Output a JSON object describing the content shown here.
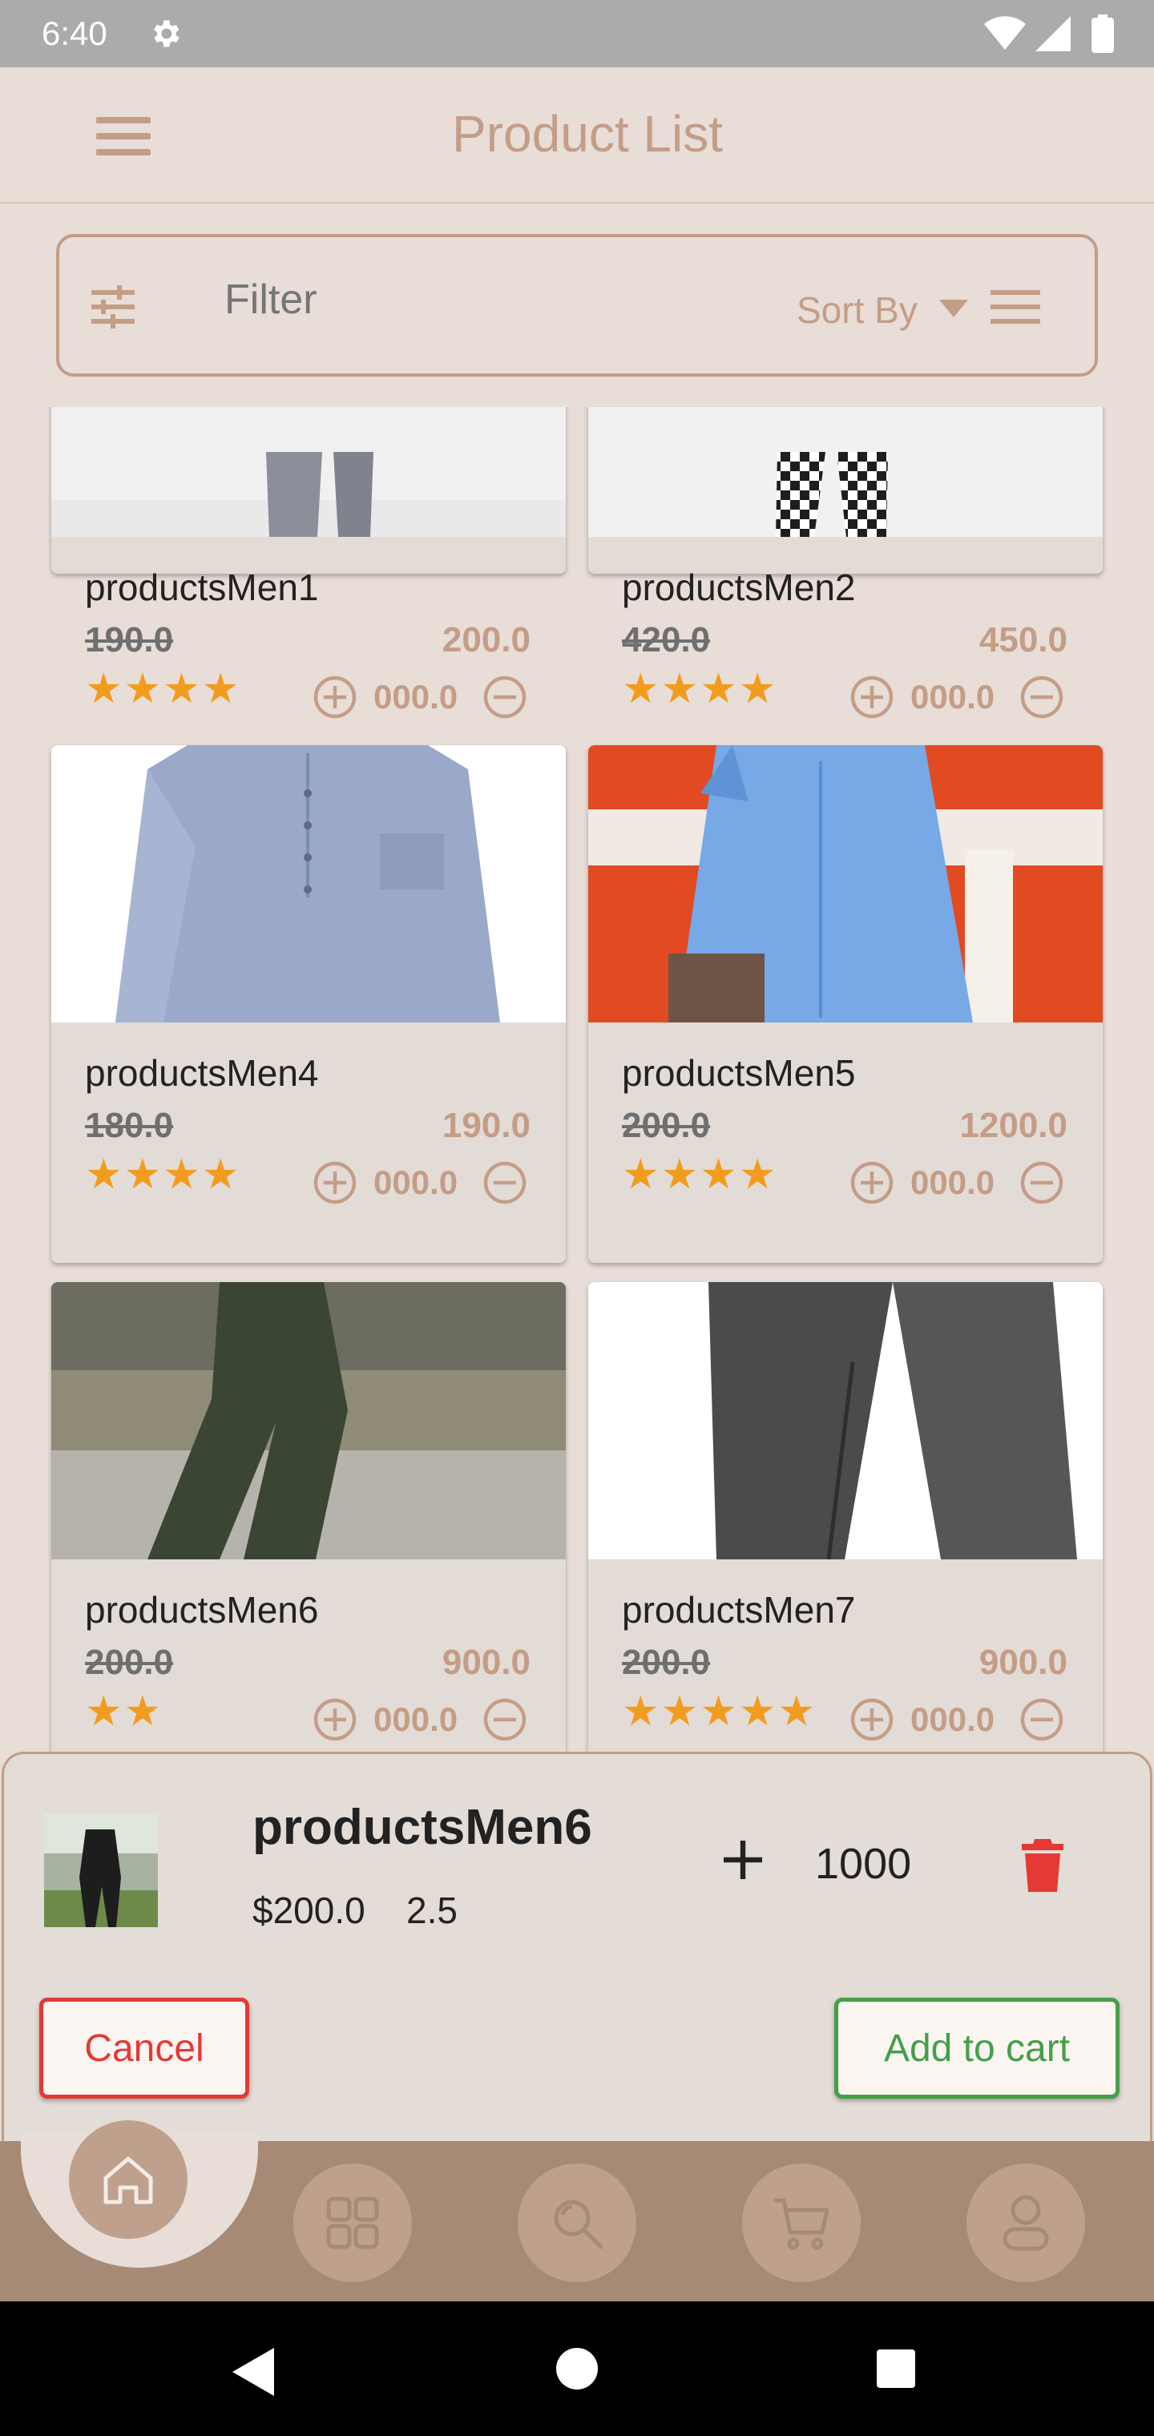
{
  "status_bar": {
    "time": "6:40",
    "icons": [
      "settings-icon",
      "wifi-icon",
      "signal-icon",
      "battery-icon"
    ]
  },
  "app_bar": {
    "title": "Product List",
    "menu_icon": "hamburger-menu-icon"
  },
  "filter_bar": {
    "placeholder": "Filter",
    "sort_label": "Sort By",
    "icons": [
      "sliders-icon",
      "caret-down-icon",
      "list-view-icon"
    ]
  },
  "products": [
    {
      "name": "productsMen1",
      "old_price": "190.0",
      "price": "200.0",
      "stars": "★★★★",
      "qty": "000.0"
    },
    {
      "name": "productsMen2",
      "old_price": "420.0",
      "price": "450.0",
      "stars": "★★★★",
      "qty": "000.0"
    },
    {
      "name": "productsMen4",
      "old_price": "180.0",
      "price": "190.0",
      "stars": "★★★★",
      "qty": "000.0"
    },
    {
      "name": "productsMen5",
      "old_price": "200.0",
      "price": "1200.0",
      "stars": "★★★★",
      "qty": "000.0"
    },
    {
      "name": "productsMen6",
      "old_price": "200.0",
      "price": "900.0",
      "stars": "★★",
      "qty": "000.0"
    },
    {
      "name": "productsMen7",
      "old_price": "200.0",
      "price": "900.0",
      "stars": "★★★★★",
      "qty": "000.0"
    }
  ],
  "sheet": {
    "name": "productsMen6",
    "price": "$200.0",
    "rating": "2.5",
    "quantity": "1000",
    "cancel_label": "Cancel",
    "add_label": "Add to cart"
  },
  "bottom_nav": {
    "items": [
      "home-icon",
      "grid-icon",
      "search-icon",
      "cart-icon",
      "profile-icon"
    ]
  },
  "colors": {
    "accent": "#c49d87",
    "nav": "#a78a76",
    "star": "#f29c1f",
    "cancel": "#e53935",
    "add": "#43a047"
  }
}
